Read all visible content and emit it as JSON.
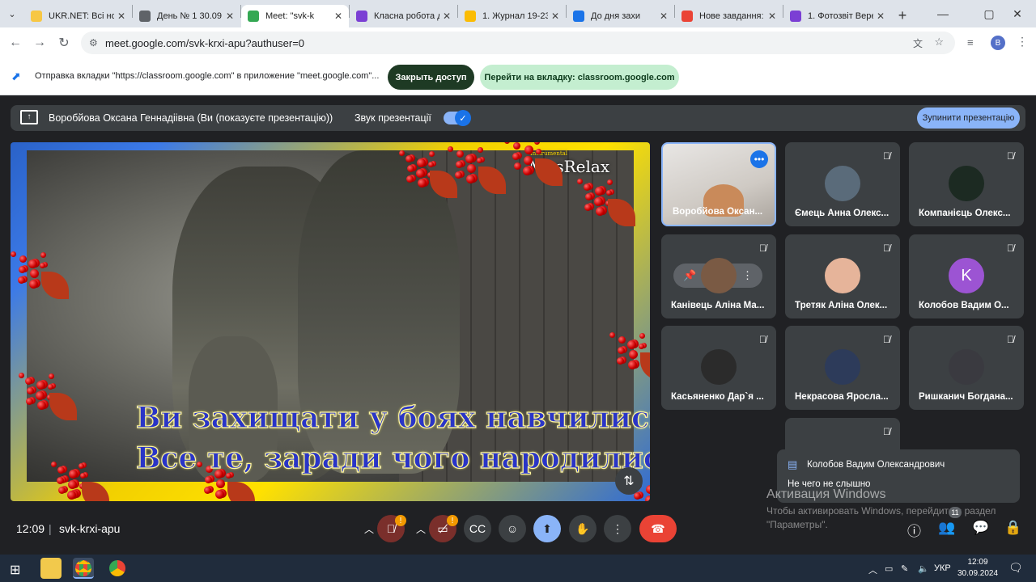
{
  "browser": {
    "tabs": [
      {
        "label": "UKR.NET: Всі новини",
        "color": "#f7c744"
      },
      {
        "label": "День № 1 30.09",
        "color": "#5f6368"
      },
      {
        "label": "Meet: \"svk-k",
        "color": "#34a853"
      },
      {
        "label": "Класна робота д",
        "color": "#7b3fd4"
      },
      {
        "label": "1. Журнал 19-23",
        "color": "#fbbc04"
      },
      {
        "label": "До дня захи",
        "color": "#1a73e8"
      },
      {
        "label": "Нове завдання:",
        "color": "#ea4335"
      },
      {
        "label": "1. Фотозвіт Вере",
        "color": "#7b3fd4"
      }
    ],
    "url": "meet.google.com/svk-krxi-apu?authuser=0",
    "profile_initial": "B"
  },
  "share_bar": {
    "text": "Отправка вкладки \"https://classroom.google.com\" в приложение \"meet.google.com\"...",
    "close_access": "Закрыть доступ",
    "goto_tab": "Перейти на вкладку: classroom.google.com"
  },
  "presentation": {
    "presenter_text": "Воробйова Оксана Геннадіівна (Ви (показуєте презентацію))",
    "audio_label": "Звук презентації",
    "stop_label": "Зупинити презентацію",
    "brand_small": "Instrumental",
    "brand": "MusRelax",
    "lyric_line1": "Ви захищати у боях навчились,",
    "lyric_line2": "Все те, заради чого народились"
  },
  "participants": [
    {
      "name": "Воробйова Оксан...",
      "self": true
    },
    {
      "name": "Ємець Анна Олекс...",
      "avatar": "#5a6b7a"
    },
    {
      "name": "Компанієць Олекс...",
      "avatar": "#1c2a22"
    },
    {
      "name": "Канівець Аліна Ма...",
      "avatar": "#7a5a44"
    },
    {
      "name": "Третяк Аліна Олек...",
      "avatar": "#e6b49a"
    },
    {
      "name": "Колобов Вадим О...",
      "initial": "K",
      "avatar": "#9c54d3"
    },
    {
      "name": "Касьяненко Дар`я ...",
      "avatar": "#2b2b2b"
    },
    {
      "name": "Некрасова Ярослa...",
      "avatar": "#2d3b5a"
    },
    {
      "name": "Ришканич Богдана...",
      "avatar": "#3a3a40"
    }
  ],
  "toast": {
    "sender": "Колобов Вадим Олександрович",
    "message": "Не чего не слышно"
  },
  "watermark": {
    "title": "Активация Windows",
    "body": "Чтобы активировать Windows, перейдите в раздел \"Параметры\"."
  },
  "meeting": {
    "time": "12:09",
    "code": "svk-krxi-apu",
    "people_count": "11",
    "warn": "!"
  },
  "taskbar": {
    "lang": "УКР",
    "time": "12:09",
    "date": "30.09.2024"
  }
}
